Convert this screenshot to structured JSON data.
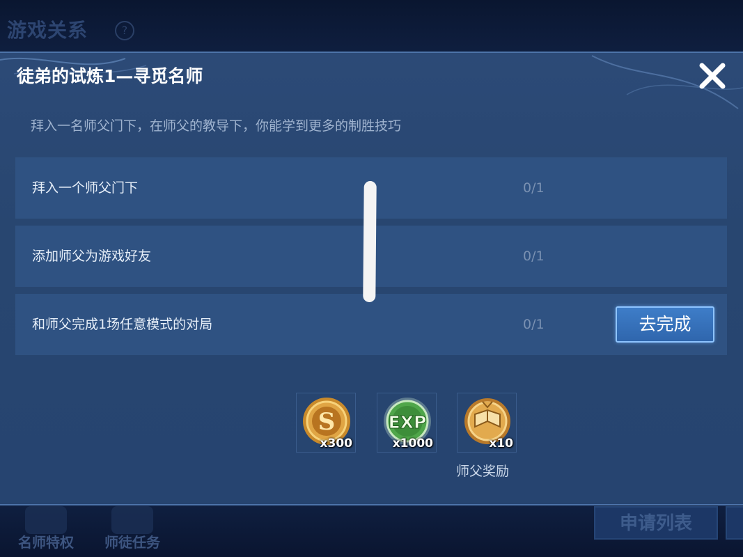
{
  "background": {
    "title": "游戏关系",
    "help_icon": "?",
    "bottom_tabs": [
      {
        "label": "名师特权",
        "icon": "badge-icon"
      },
      {
        "label": "师徒任务",
        "icon": "task-icon"
      }
    ],
    "apply_list_label": "申请列表"
  },
  "modal": {
    "title": "徒弟的试炼1—寻觅名师",
    "close_icon": "close-icon",
    "subtitle": "拜入一名师父门下，在师父的教导下，你能学到更多的制胜技巧",
    "tasks": [
      {
        "label": "拜入一个师父门下",
        "progress": "0/1"
      },
      {
        "label": "添加师父为游戏好友",
        "progress": "0/1"
      },
      {
        "label": "和师父完成1场任意模式的对局",
        "progress": "0/1",
        "action": "去完成"
      }
    ],
    "rewards": [
      {
        "icon": "gold-coin-icon",
        "count": "x300"
      },
      {
        "icon": "exp-icon",
        "count": "x1000"
      },
      {
        "icon": "book-medal-icon",
        "count": "x10",
        "caption": "师父奖励"
      }
    ]
  },
  "colors": {
    "modal_bg": "#2c4a77",
    "row_bg": "#2f5282",
    "accent_button": "#3e7dc8"
  }
}
